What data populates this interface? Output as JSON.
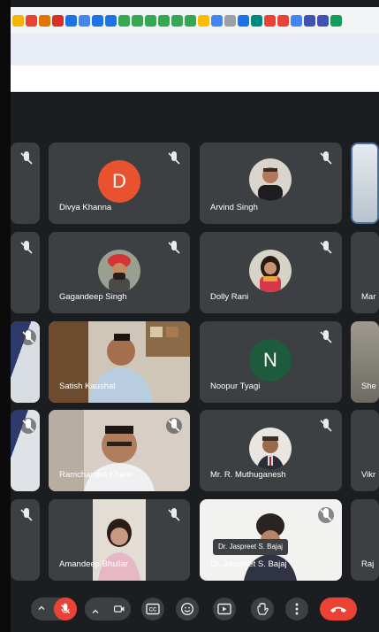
{
  "participants": {
    "divya": "Divya Khanna",
    "divya_initial": "D",
    "arvind": "Arvind Singh",
    "gagandeep": "Gagandeep Singh",
    "dolly": "Dolly Rani",
    "mar": "Mar",
    "satish": "Satish Kaushal",
    "noopur": "Noopur Tyagi",
    "noopur_initial": "N",
    "she": "She",
    "ramchandra": "Ramchandra Khare",
    "muthuganesh": "Mr. R. Muthuganesh",
    "vikr": "Vikr",
    "amandeep": "Amandeep Bhullar",
    "jaspreet": "Dr. Jaspreet S. Bajaj",
    "raj": "Raj"
  },
  "tooltip": {
    "text": "Dr. Jaspreet S. Bajaj"
  },
  "colors": {
    "tile_bg": "#3c4043",
    "avatar_d": "#e8522f",
    "avatar_n": "#1e5a3c",
    "hangup": "#ea4335",
    "mic_off": "#ea4335"
  },
  "toolbar": {
    "mic": "mic-off-icon",
    "camera": "camera-icon",
    "captions": "CC",
    "emoji": "emoji-icon",
    "present": "present-icon",
    "hand": "raise-hand-icon",
    "more": "more-vert-icon",
    "leave": "call-end-icon"
  }
}
